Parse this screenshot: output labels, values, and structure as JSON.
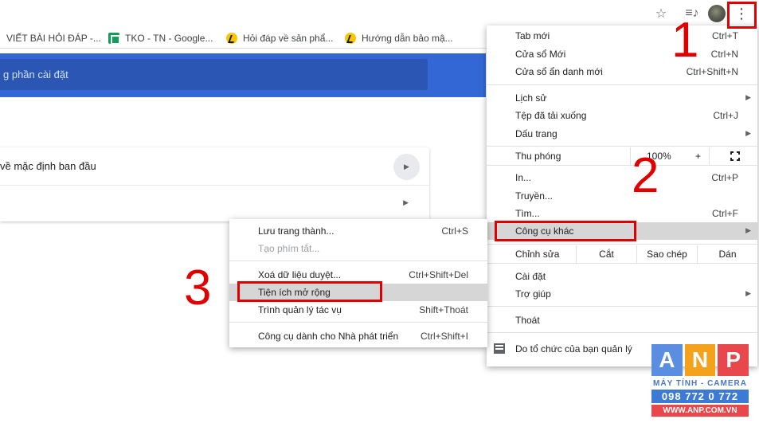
{
  "toolbar": {
    "icons": [
      "star-icon",
      "media-control-icon",
      "avatar",
      "more-vert-icon"
    ],
    "star_glyph": "☆",
    "media_glyph": "≡♪",
    "more_glyph": "⋮"
  },
  "bookmarks": [
    {
      "label": "VIẾT BÀI HỎI ĐÁP -...",
      "icon": "none"
    },
    {
      "label": "TKO - TN - Google...",
      "icon": "sheets-icon"
    },
    {
      "label": "Hỏi đáp về sản phẩ...",
      "icon": "runner-icon"
    },
    {
      "label": "Hướng dẫn bảo mậ...",
      "icon": "runner-icon"
    }
  ],
  "settings": {
    "search_placeholder": "g phần cài đặt",
    "reset_row_label": "về mặc định ban đầu",
    "arrow_glyph": "▶"
  },
  "menu": {
    "items": [
      {
        "label": "Tab mới",
        "shortcut": "Ctrl+T"
      },
      {
        "label": "Cửa sổ Mới",
        "shortcut": "Ctrl+N"
      },
      {
        "label": "Cửa sổ ẩn danh mới",
        "shortcut": "Ctrl+Shift+N"
      },
      {
        "label": "Lịch sử",
        "shortcut": ""
      },
      {
        "label": "Tệp đã tải xuống",
        "shortcut": "Ctrl+J"
      },
      {
        "label": "Dấu trang",
        "shortcut": ""
      },
      {
        "label": "In...",
        "shortcut": "Ctrl+P"
      },
      {
        "label": "Truyền...",
        "shortcut": ""
      },
      {
        "label": "Tìm...",
        "shortcut": "Ctrl+F"
      },
      {
        "label": "Công cụ khác",
        "shortcut": ""
      },
      {
        "label": "Cài đặt",
        "shortcut": ""
      },
      {
        "label": "Trợ giúp",
        "shortcut": ""
      },
      {
        "label": "Thoát",
        "shortcut": ""
      },
      {
        "label": "Do tổ chức của bạn quản lý",
        "shortcut": ""
      }
    ],
    "zoom": {
      "label": "Thu phóng",
      "value": "100%",
      "plus": "+"
    },
    "edit": {
      "label": "Chỉnh sửa",
      "cut": "Cắt",
      "copy": "Sao chép",
      "paste": "Dán"
    },
    "submenu_arrow": "▶"
  },
  "submenu": {
    "items": [
      {
        "label": "Lưu trang thành...",
        "shortcut": "Ctrl+S"
      },
      {
        "label": "Tạo phím tắt...",
        "shortcut": ""
      },
      {
        "label": "Xoá dữ liệu duyệt...",
        "shortcut": "Ctrl+Shift+Del"
      },
      {
        "label": "Tiện ích mở rộng",
        "shortcut": ""
      },
      {
        "label": "Trình quản lý tác vụ",
        "shortcut": "Shift+Thoát"
      },
      {
        "label": "Công cụ dành cho Nhà phát triển",
        "shortcut": "Ctrl+Shift+I"
      }
    ]
  },
  "annotations": {
    "step1": "1",
    "step2": "2",
    "step3": "3",
    "color": "#e00000"
  },
  "watermark": {
    "letters": [
      "A",
      "N",
      "P"
    ],
    "letter_colors": [
      "#5b8ee0",
      "#f4a21c",
      "#e8474b"
    ],
    "tagline": "MÁY TÍNH - CAMERA",
    "phone": "098 772 0 772",
    "url": "WWW.ANP.COM.VN"
  },
  "colors": {
    "accent_blue": "#3367d6",
    "highlight_gray": "#d6d6d6"
  }
}
